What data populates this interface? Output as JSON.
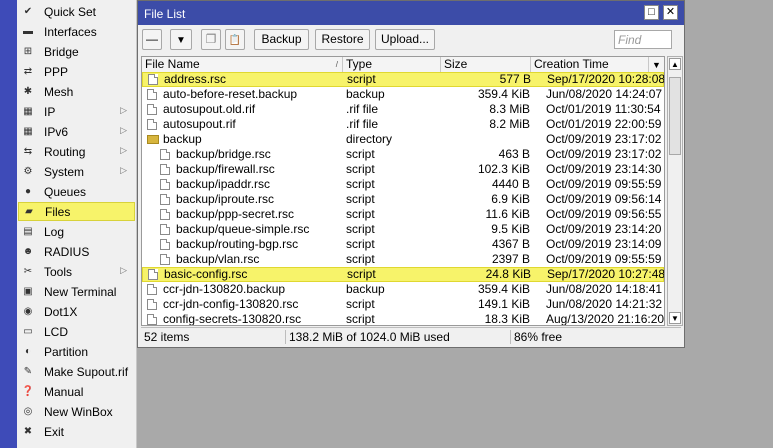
{
  "sidebar": {
    "items": [
      {
        "label": "Quick Set",
        "icon": "quick-set-icon",
        "glyph": "✔",
        "submenu": false,
        "selected": false
      },
      {
        "label": "Interfaces",
        "icon": "interfaces-icon",
        "glyph": "▬",
        "submenu": false,
        "selected": false
      },
      {
        "label": "Bridge",
        "icon": "bridge-icon",
        "glyph": "⊞",
        "submenu": false,
        "selected": false
      },
      {
        "label": "PPP",
        "icon": "ppp-icon",
        "glyph": "⇄",
        "submenu": false,
        "selected": false
      },
      {
        "label": "Mesh",
        "icon": "mesh-icon",
        "glyph": "✱",
        "submenu": false,
        "selected": false
      },
      {
        "label": "IP",
        "icon": "ip-icon",
        "glyph": "▦",
        "submenu": true,
        "selected": false
      },
      {
        "label": "IPv6",
        "icon": "ipv6-icon",
        "glyph": "▦",
        "submenu": true,
        "selected": false
      },
      {
        "label": "Routing",
        "icon": "routing-icon",
        "glyph": "⇆",
        "submenu": true,
        "selected": false
      },
      {
        "label": "System",
        "icon": "system-icon",
        "glyph": "⚙",
        "submenu": true,
        "selected": false
      },
      {
        "label": "Queues",
        "icon": "queues-icon",
        "glyph": "●",
        "submenu": false,
        "selected": false
      },
      {
        "label": "Files",
        "icon": "files-icon",
        "glyph": "▰",
        "submenu": false,
        "selected": true
      },
      {
        "label": "Log",
        "icon": "log-icon",
        "glyph": "▤",
        "submenu": false,
        "selected": false
      },
      {
        "label": "RADIUS",
        "icon": "radius-icon",
        "glyph": "☻",
        "submenu": false,
        "selected": false
      },
      {
        "label": "Tools",
        "icon": "tools-icon",
        "glyph": "✂",
        "submenu": true,
        "selected": false
      },
      {
        "label": "New Terminal",
        "icon": "terminal-icon",
        "glyph": "▣",
        "submenu": false,
        "selected": false
      },
      {
        "label": "Dot1X",
        "icon": "dot1x-icon",
        "glyph": "◉",
        "submenu": false,
        "selected": false
      },
      {
        "label": "LCD",
        "icon": "lcd-icon",
        "glyph": "▭",
        "submenu": false,
        "selected": false
      },
      {
        "label": "Partition",
        "icon": "partition-icon",
        "glyph": "◐",
        "submenu": false,
        "selected": false
      },
      {
        "label": "Make Supout.rif",
        "icon": "supout-icon",
        "glyph": "✎",
        "submenu": false,
        "selected": false
      },
      {
        "label": "Manual",
        "icon": "manual-icon",
        "glyph": "❓",
        "submenu": false,
        "selected": false
      },
      {
        "label": "New WinBox",
        "icon": "winbox-icon",
        "glyph": "◎",
        "submenu": false,
        "selected": false
      },
      {
        "label": "Exit",
        "icon": "exit-icon",
        "glyph": "✖",
        "submenu": false,
        "selected": false
      }
    ]
  },
  "window": {
    "title": "File List",
    "maximize_glyph": "□",
    "close_glyph": "✕"
  },
  "toolbar": {
    "remove_glyph": "—",
    "filter_glyph": "▼",
    "copy_glyph": "❐",
    "paste_glyph": "📋",
    "backup_label": "Backup",
    "restore_label": "Restore",
    "upload_label": "Upload...",
    "find_placeholder": "Find"
  },
  "table": {
    "columns": [
      "File Name",
      "Type",
      "Size",
      "Creation Time"
    ],
    "rows": [
      {
        "name": "address.rsc",
        "type": "script",
        "size": "577 B",
        "date": "Sep/17/2020 10:28:08",
        "indent": false,
        "folder": false,
        "highlight": true
      },
      {
        "name": "auto-before-reset.backup",
        "type": "backup",
        "size": "359.4 KiB",
        "date": "Jun/08/2020 14:24:07",
        "indent": false,
        "folder": false,
        "highlight": false
      },
      {
        "name": "autosupout.old.rif",
        "type": ".rif file",
        "size": "8.3 MiB",
        "date": "Oct/01/2019 11:30:54",
        "indent": false,
        "folder": false,
        "highlight": false
      },
      {
        "name": "autosupout.rif",
        "type": ".rif file",
        "size": "8.2 MiB",
        "date": "Oct/01/2019 22:00:59",
        "indent": false,
        "folder": false,
        "highlight": false
      },
      {
        "name": "backup",
        "type": "directory",
        "size": "",
        "date": "Oct/09/2019 23:17:02",
        "indent": false,
        "folder": true,
        "highlight": false
      },
      {
        "name": "backup/bridge.rsc",
        "type": "script",
        "size": "463 B",
        "date": "Oct/09/2019 23:17:02",
        "indent": true,
        "folder": false,
        "highlight": false
      },
      {
        "name": "backup/firewall.rsc",
        "type": "script",
        "size": "102.3 KiB",
        "date": "Oct/09/2019 23:14:30",
        "indent": true,
        "folder": false,
        "highlight": false
      },
      {
        "name": "backup/ipaddr.rsc",
        "type": "script",
        "size": "4440 B",
        "date": "Oct/09/2019 09:55:59",
        "indent": true,
        "folder": false,
        "highlight": false
      },
      {
        "name": "backup/iproute.rsc",
        "type": "script",
        "size": "6.9 KiB",
        "date": "Oct/09/2019 09:56:14",
        "indent": true,
        "folder": false,
        "highlight": false
      },
      {
        "name": "backup/ppp-secret.rsc",
        "type": "script",
        "size": "11.6 KiB",
        "date": "Oct/09/2019 09:56:55",
        "indent": true,
        "folder": false,
        "highlight": false
      },
      {
        "name": "backup/queue-simple.rsc",
        "type": "script",
        "size": "9.5 KiB",
        "date": "Oct/09/2019 23:14:20",
        "indent": true,
        "folder": false,
        "highlight": false
      },
      {
        "name": "backup/routing-bgp.rsc",
        "type": "script",
        "size": "4367 B",
        "date": "Oct/09/2019 23:14:09",
        "indent": true,
        "folder": false,
        "highlight": false
      },
      {
        "name": "backup/vlan.rsc",
        "type": "script",
        "size": "2397 B",
        "date": "Oct/09/2019 09:55:59",
        "indent": true,
        "folder": false,
        "highlight": false
      },
      {
        "name": "basic-config.rsc",
        "type": "script",
        "size": "24.8 KiB",
        "date": "Sep/17/2020 10:27:48",
        "indent": false,
        "folder": false,
        "highlight": true
      },
      {
        "name": "ccr-jdn-130820.backup",
        "type": "backup",
        "size": "359.4 KiB",
        "date": "Jun/08/2020 14:18:41",
        "indent": false,
        "folder": false,
        "highlight": false
      },
      {
        "name": "ccr-jdn-config-130820.rsc",
        "type": "script",
        "size": "149.1 KiB",
        "date": "Jun/08/2020 14:21:32",
        "indent": false,
        "folder": false,
        "highlight": false
      },
      {
        "name": "config-secrets-130820.rsc",
        "type": "script",
        "size": "18.3 KiB",
        "date": "Aug/13/2020 21:16:20",
        "indent": false,
        "folder": false,
        "highlight": false
      }
    ]
  },
  "status": {
    "items_count": "52 items",
    "usage": "138.2 MiB of 1024.0 MiB used",
    "free": "86% free"
  },
  "colors": {
    "highlight": "#f7f36a",
    "titlebar": "#3c4ca8",
    "side_strip": "#3e4bb8"
  }
}
